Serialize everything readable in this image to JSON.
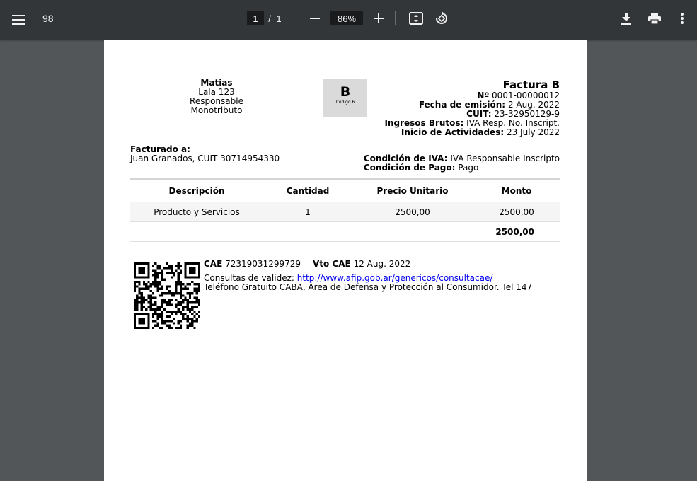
{
  "toolbar": {
    "doc_title": "98",
    "page_current": "1",
    "page_sep": "/",
    "page_total": "1",
    "zoom": "86%"
  },
  "invoice": {
    "seller": {
      "name": "Matias",
      "address": "Lala 123",
      "condition": "Responsable Monotributo"
    },
    "letter": "B",
    "letter_code": "Código 6",
    "title": "Factura B",
    "number_label": "Nº",
    "number": "0001-00000012",
    "date_label": "Fecha de emisión:",
    "date": "2 Aug. 2022",
    "cuit_label": "CUIT:",
    "cuit": "23-32950129-9",
    "iibb_label": "Ingresos Brutos:",
    "iibb": "IVA Resp. No. Inscript.",
    "start_label": "Inicio de Actividades:",
    "start": "23 July 2022",
    "client_label": "Facturado a:",
    "client": "Juan Granados, CUIT 30714954330",
    "iva_label": "Condición de IVA:",
    "iva": "IVA Responsable Inscripto",
    "pay_label": "Condición de Pago:",
    "pay": "Pago",
    "table": {
      "headers": [
        "Descripción",
        "Cantidad",
        "Precio Unitario",
        "Monto"
      ],
      "rows": [
        [
          "Producto y Servicios",
          "1",
          "2500,00",
          "2500,00"
        ]
      ],
      "total": "2500,00"
    },
    "cae_label": "CAE",
    "cae": "72319031299729",
    "vto_label": "Vto CAE",
    "vto": "12 Aug. 2022",
    "consult_label": "Consultas de validez:",
    "consult_url": "http://www.afip.gob.ar/genericos/consultacae/",
    "phone_text": "Teléfono Gratuito CABA, Área de Defensa y Protección al Consumidor. Tel 147"
  }
}
